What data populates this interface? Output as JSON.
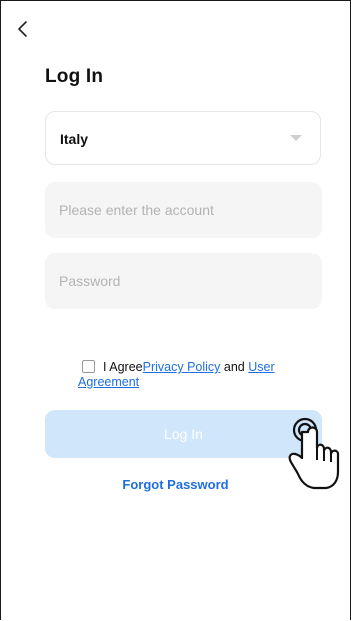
{
  "header": {
    "back_icon": "chevron-left-icon"
  },
  "page": {
    "title": "Log In"
  },
  "country_select": {
    "value": "Italy",
    "icon": "caret-down-icon"
  },
  "account_field": {
    "placeholder": "Please enter the account"
  },
  "password_field": {
    "placeholder": "Password"
  },
  "agreement": {
    "prefix": "I Agree",
    "privacy_link": "Privacy Policy",
    "joiner": "and",
    "user_agreement_link": "User Agreement",
    "checked": false
  },
  "login_button": {
    "label": "Log In"
  },
  "forgot_password": {
    "label": "Forgot Password"
  },
  "pointer": {
    "icon": "hand-pointer-icon"
  },
  "colors": {
    "accent": "#1f6fe0",
    "button_disabled": "#cfe6fb",
    "field_bg": "#f5f5f5"
  }
}
